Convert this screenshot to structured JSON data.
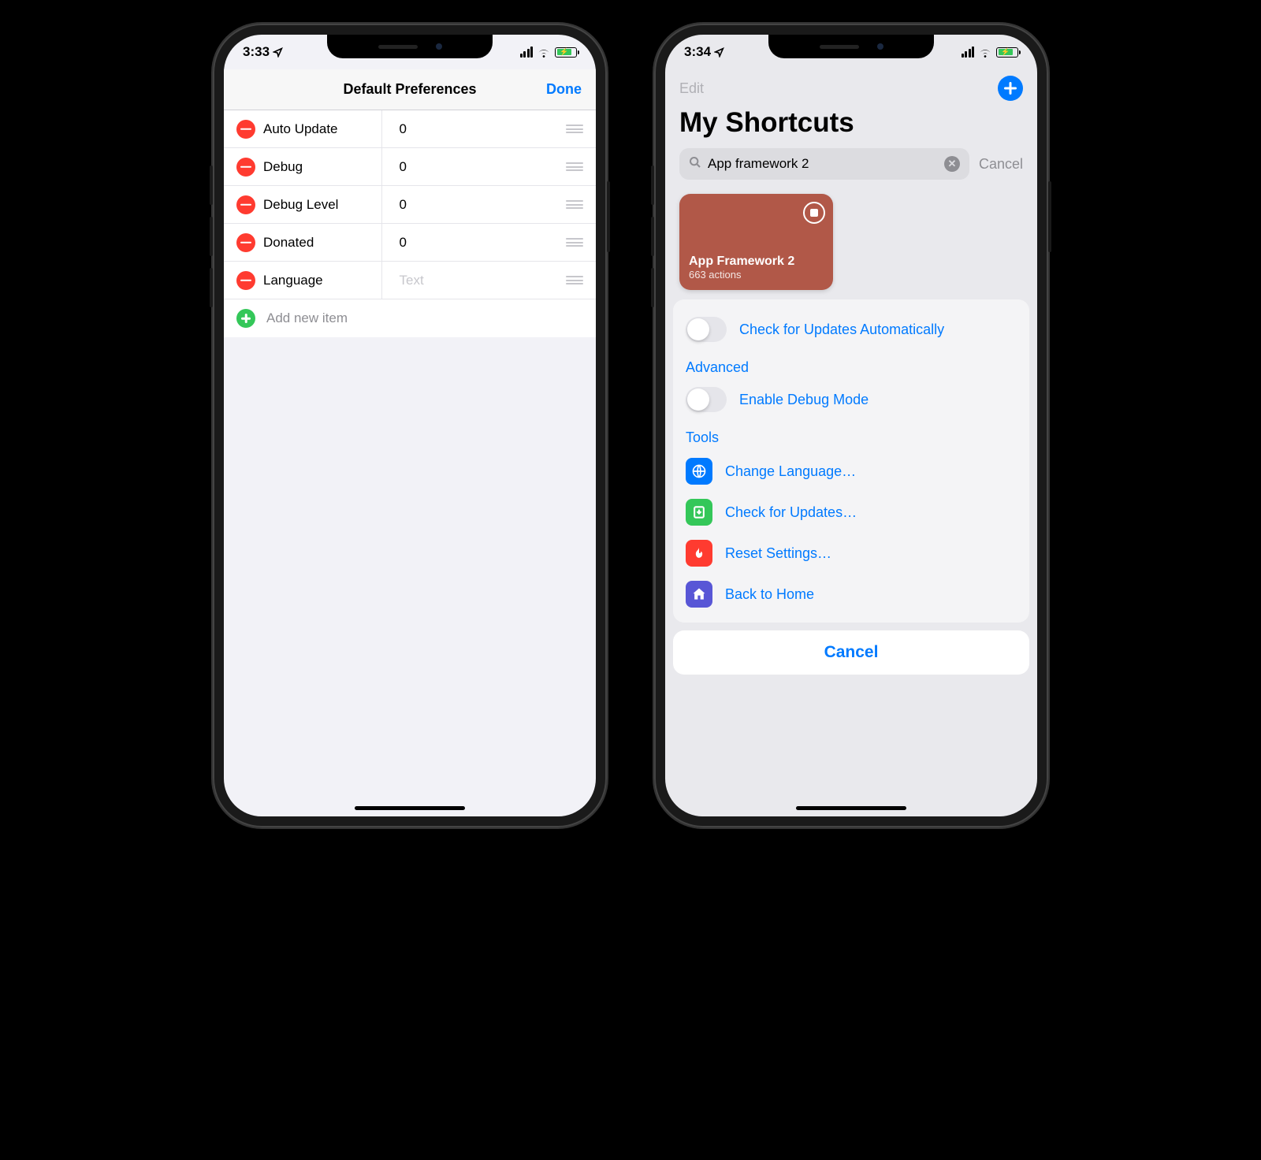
{
  "left": {
    "status": {
      "time": "3:33"
    },
    "nav": {
      "title": "Default Preferences",
      "done": "Done"
    },
    "rows": [
      {
        "key": "Auto Update",
        "value": "0"
      },
      {
        "key": "Debug",
        "value": "0"
      },
      {
        "key": "Debug Level",
        "value": "0"
      },
      {
        "key": "Donated",
        "value": "0"
      },
      {
        "key": "Language",
        "placeholder": "Text"
      }
    ],
    "add_label": "Add new item"
  },
  "right": {
    "status": {
      "time": "3:34"
    },
    "topbar": {
      "edit": "Edit"
    },
    "title": "My Shortcuts",
    "search": {
      "query": "App framework 2",
      "cancel": "Cancel"
    },
    "card": {
      "name": "App Framework 2",
      "meta": "663 actions"
    },
    "sheet": {
      "check_auto": "Check for Updates Automatically",
      "section_advanced": "Advanced",
      "enable_debug": "Enable Debug Mode",
      "section_tools": "Tools",
      "tools": [
        {
          "label": "Change Language…",
          "color": "blue",
          "icon": "globe"
        },
        {
          "label": "Check for Updates…",
          "color": "green",
          "icon": "download"
        },
        {
          "label": "Reset Settings…",
          "color": "red",
          "icon": "flame"
        },
        {
          "label": "Back to Home",
          "color": "purple",
          "icon": "home"
        }
      ],
      "cancel": "Cancel"
    }
  }
}
